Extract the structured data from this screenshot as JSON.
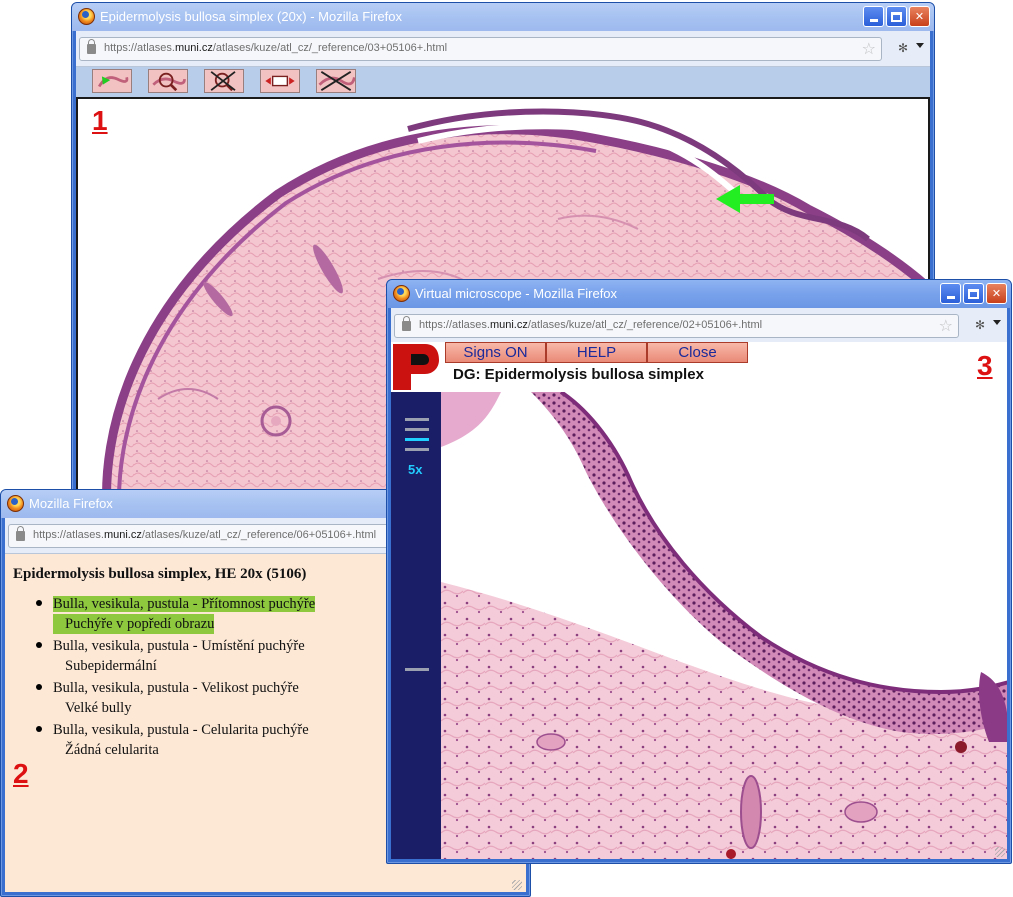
{
  "window1": {
    "title": "Epidermolysis bullosa simplex (20x) - Mozilla Firefox",
    "url_prefix": "https://atlases.",
    "url_domain": "muni.cz",
    "url_suffix": "/atlases/kuze/atl_cz/_reference/03+05106+.html",
    "label": "1",
    "toolbar": [
      {
        "icon": "navigate-arrow-icon"
      },
      {
        "icon": "magnify-icon"
      },
      {
        "icon": "no-magnify-icon"
      },
      {
        "icon": "resize-icon"
      },
      {
        "icon": "close-image-icon"
      }
    ]
  },
  "window2": {
    "title": "Mozilla Firefox",
    "url_prefix": "https://atlases.",
    "url_domain": "muni.cz",
    "url_suffix": "/atlases/kuze/atl_cz/_reference/06+05106+.html",
    "heading": "Epidermolysis bullosa simplex, HE 20x (5106)",
    "label": "2",
    "items": [
      {
        "line1": "Bulla, vesikula, pustula - Přítomnost puchýře",
        "line2": "Puchýře v popředí obrazu",
        "highlighted": true
      },
      {
        "line1": "Bulla, vesikula, pustula - Umístění puchýře",
        "line2": "Subepidermální",
        "highlighted": false
      },
      {
        "line1": "Bulla, vesikula, pustula - Velikost puchýře",
        "line2": "Velké bully",
        "highlighted": false
      },
      {
        "line1": "Bulla, vesikula, pustula - Celularita puchýře",
        "line2": "Žádná celularita",
        "highlighted": false
      }
    ],
    "highlight_color": "#8dc83e"
  },
  "window3": {
    "title": "Virtual microscope - Mozilla Firefox",
    "url_prefix": "https://atlases.",
    "url_domain": "muni.cz",
    "url_suffix": "/atlases/kuze/atl_cz/_reference/02+05106+.html",
    "buttons": {
      "signs": "Signs ON",
      "help": "HELP",
      "close": "Close"
    },
    "diagnosis": "DG: Epidermolysis bullosa simplex",
    "zoom": "5x",
    "label": "3"
  },
  "colors": {
    "accent_red": "#dd1111",
    "arrow_green": "#22ee22",
    "sidebar_navy": "#1a1e66",
    "zoom_cyan": "#22ccff"
  }
}
